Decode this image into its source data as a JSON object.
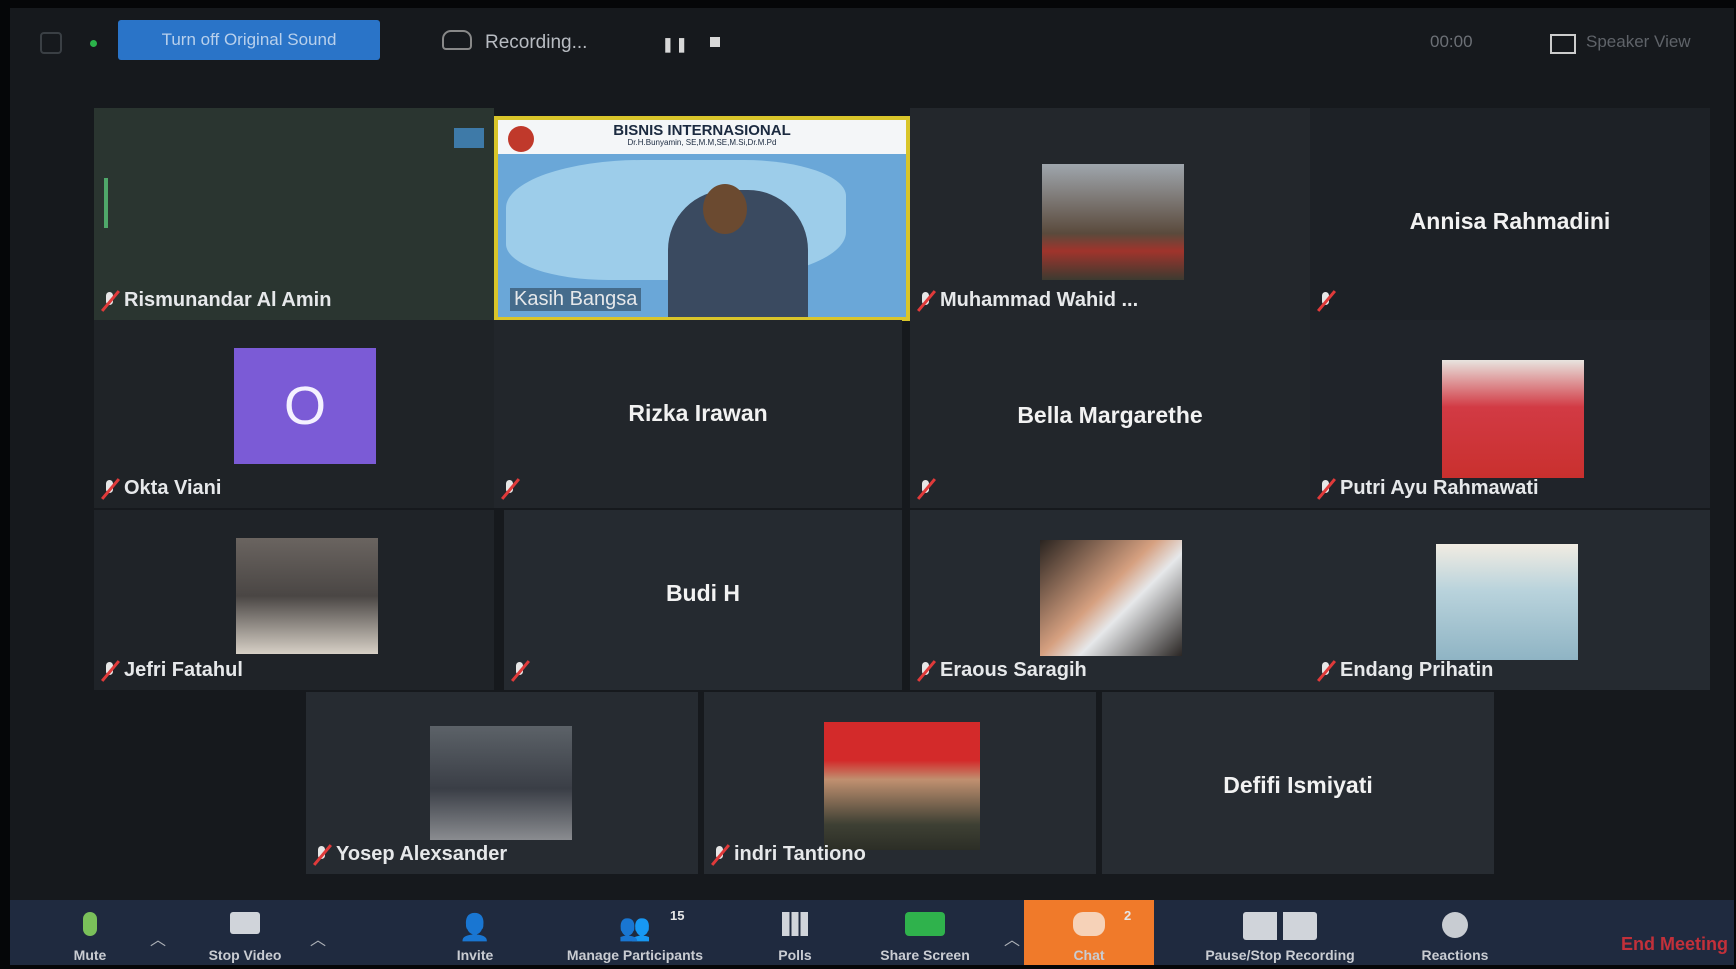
{
  "topbar": {
    "sound_button": "Turn off Original Sound",
    "recording": "Recording...",
    "view_label": "Speaker View",
    "time": "00:00"
  },
  "tiles": {
    "r1": [
      "Rismunandar Al Amin",
      "Kasih Bangsa",
      "Muhammad Wahid ...",
      "Annisa Rahmadini"
    ],
    "r2": [
      "Okta Viani",
      "Rizka Irawan",
      "Bella Margarethe",
      "Putri Ayu Rahmawati"
    ],
    "r3": [
      "Jefri Fatahul",
      "Budi H",
      "Eraous Saragih",
      "Endang Prihatin"
    ],
    "r4": [
      "Yosep Alexsander",
      "indri Tantiono",
      "Defifi Ismiyati"
    ]
  },
  "avatar_letter": "O",
  "slide": {
    "title": "BISNIS INTERNASIONAL",
    "subtitle": "Dr.H.Bunyamin, SE,M.M,SE,M.Si,Dr.M.Pd"
  },
  "toolbar": {
    "mute": "Mute",
    "video": "Stop Video",
    "invite": "Invite",
    "participants": "Manage Participants",
    "participants_count": "15",
    "polls": "Polls",
    "share": "Share Screen",
    "chat": "Chat",
    "chat_count": "2",
    "record": "Pause/Stop Recording",
    "reactions": "Reactions",
    "end": "End Meeting"
  },
  "colors": {
    "accent": "#2a74c8",
    "active_border": "#d9c52a",
    "chat": "#f07a2a",
    "end": "#c2303a"
  }
}
